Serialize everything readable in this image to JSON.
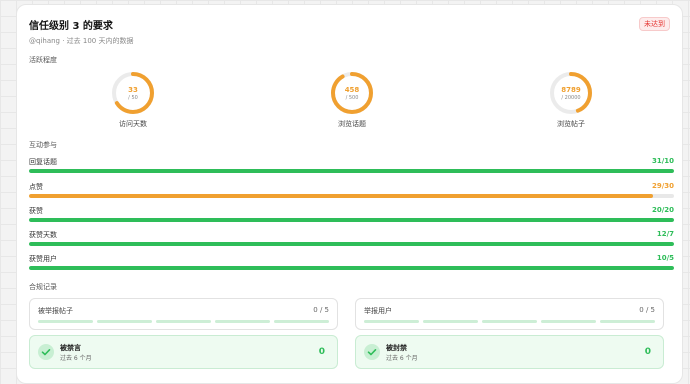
{
  "header": {
    "title": "信任级别 3 的要求",
    "status": "未达到",
    "subtitle": "@qihang · 过去 100 天内的数据"
  },
  "activity": {
    "section_label": "活跃程度",
    "rings": [
      {
        "value": "33",
        "total": "/ 50",
        "label": "访问天数",
        "fraction": 0.66
      },
      {
        "value": "458",
        "total": "/ 500",
        "label": "浏览话题",
        "fraction": 0.916
      },
      {
        "value": "8789",
        "total": "/ 20000",
        "label": "浏览帖子",
        "fraction": 0.44
      }
    ]
  },
  "engagement": {
    "section_label": "互动参与",
    "rows": [
      {
        "label": "回复话题",
        "value": "31/10",
        "fraction": 1.0,
        "status": "ok"
      },
      {
        "label": "点赞",
        "value": "29/30",
        "fraction": 0.967,
        "status": "warn"
      },
      {
        "label": "获赞",
        "value": "20/20",
        "fraction": 1.0,
        "status": "ok"
      },
      {
        "label": "获赞天数",
        "value": "12/7",
        "fraction": 1.0,
        "status": "ok"
      },
      {
        "label": "获赞用户",
        "value": "10/5",
        "fraction": 1.0,
        "status": "ok"
      }
    ]
  },
  "compliance": {
    "section_label": "合规记录",
    "reports": [
      {
        "label": "被举报帖子",
        "value": "0 / 5"
      },
      {
        "label": "举报用户",
        "value": "0 / 5"
      }
    ],
    "penalties": [
      {
        "title": "被禁言",
        "subtitle": "过去 6 个月",
        "value": "0"
      },
      {
        "title": "被封禁",
        "subtitle": "过去 6 个月",
        "value": "0"
      }
    ]
  },
  "colors": {
    "ok": "#2ebd59",
    "warn": "#f0a030",
    "danger": "#e53935"
  }
}
